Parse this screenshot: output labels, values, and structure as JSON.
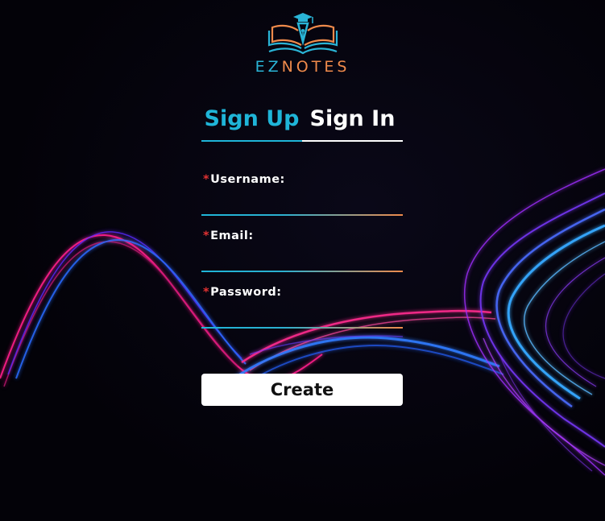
{
  "logo": {
    "icon": "book-pen-graduation-cap-icon",
    "text_part1": "EZ",
    "text_part2": "NOTES",
    "colors": {
      "blue": "#2ab4d6",
      "orange": "#ef8a4b"
    }
  },
  "tabs": [
    {
      "label": "Sign Up",
      "active": true
    },
    {
      "label": "Sign In",
      "active": false
    }
  ],
  "form": {
    "fields": [
      {
        "required_mark": "*",
        "label": "Username:",
        "value": ""
      },
      {
        "required_mark": "*",
        "label": "Email:",
        "value": ""
      },
      {
        "required_mark": "*",
        "label": "Password:",
        "value": ""
      }
    ],
    "submit_label": "Create"
  },
  "colors": {
    "accent": "#1fb5d8",
    "required": "#e23232",
    "underline_end": "#ef8a4b",
    "background": "#04030a"
  }
}
